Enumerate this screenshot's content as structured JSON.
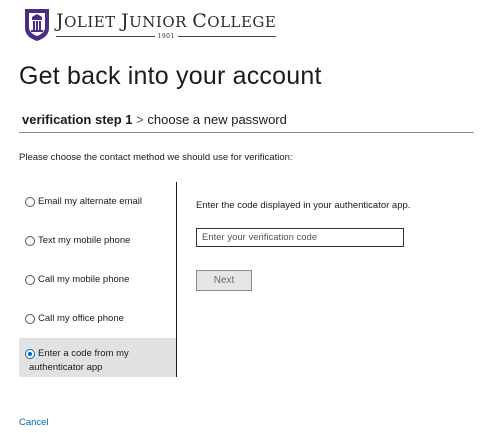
{
  "logo": {
    "name_initial_1": "J",
    "name_rest_1": "OLIET ",
    "name_initial_2": "J",
    "name_rest_2": "UNIOR ",
    "name_initial_3": "C",
    "name_rest_3": "OLLEGE",
    "year": "1901",
    "shield_color": "#4b2e83"
  },
  "page": {
    "title": "Get back into your account"
  },
  "steps": {
    "current": "verification step 1",
    "separator": ">",
    "next": "choose a new password"
  },
  "instruction": "Please choose the contact method we should use for verification:",
  "methods": [
    {
      "label": "Email my alternate email",
      "selected": false
    },
    {
      "label": "Text my mobile phone",
      "selected": false
    },
    {
      "label": "Call my mobile phone",
      "selected": false
    },
    {
      "label": "Call my office phone",
      "selected": false
    },
    {
      "label_line1": "Enter a code from my",
      "label_line2": "authenticator app",
      "selected": true
    }
  ],
  "authenticator": {
    "prompt": "Enter the code displayed in your authenticator app.",
    "input_placeholder": "Enter your verification code",
    "input_value": "",
    "next_label": "Next"
  },
  "cancel_label": "Cancel",
  "colors": {
    "link": "#0067b8",
    "selected_bg": "#e2e2e2",
    "button_bg": "#e6e6e6"
  }
}
